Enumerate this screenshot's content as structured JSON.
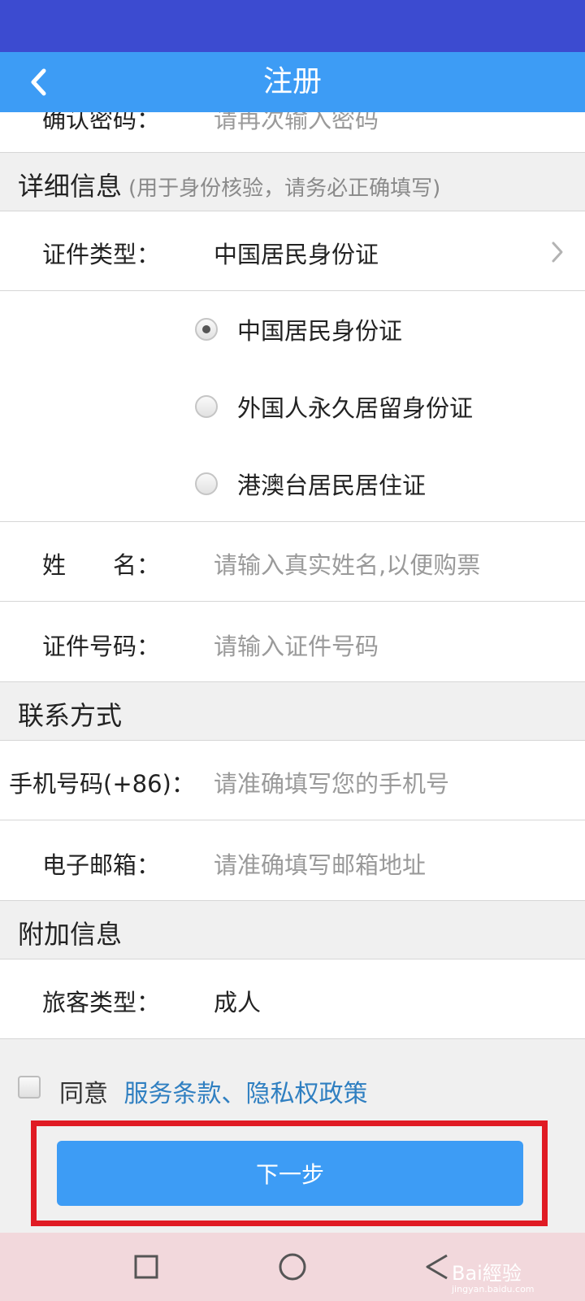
{
  "header": {
    "title": "注册"
  },
  "partial_row": {
    "label": "确认密码：",
    "placeholder": "请再次输入密码"
  },
  "detail_section": {
    "title": "详细信息",
    "hint": "(用于身份核验，请务必正确填写)"
  },
  "id_type": {
    "label": "证件类型：",
    "value": "中国居民身份证"
  },
  "id_options": [
    {
      "label": "中国居民身份证",
      "checked": true
    },
    {
      "label": "外国人永久居留身份证",
      "checked": false
    },
    {
      "label": "港澳台居民居住证",
      "checked": false
    }
  ],
  "name_field": {
    "label": "姓　　名：",
    "placeholder": "请输入真实姓名,以便购票"
  },
  "id_number_field": {
    "label": "证件号码：",
    "placeholder": "请输入证件号码"
  },
  "contact_section": {
    "title": "联系方式"
  },
  "phone_field": {
    "label": "手机号码(+86)：",
    "placeholder": "请准确填写您的手机号"
  },
  "email_field": {
    "label": "电子邮箱：",
    "placeholder": "请准确填写邮箱地址"
  },
  "extra_section": {
    "title": "附加信息"
  },
  "passenger_type": {
    "label": "旅客类型：",
    "value": "成人"
  },
  "agreement": {
    "prefix": "同意",
    "terms": "服务条款",
    "separator": "、",
    "privacy": "隐私权政策",
    "checked": false
  },
  "next_button": {
    "label": "下一步"
  },
  "watermark": {
    "brand": "Bai經验",
    "url": "jingyan.baidu.com"
  },
  "colors": {
    "status_bar": "#3c4bd0",
    "app_bar": "#3d9cf5",
    "link": "#2f7fc1",
    "highlight_border": "#e01b24",
    "nav_bar": "#f2d8dc"
  },
  "icons": {
    "back": "chevron-left",
    "select": "chevron-right",
    "nav_recent": "square",
    "nav_home": "circle",
    "nav_back": "triangle-left"
  }
}
